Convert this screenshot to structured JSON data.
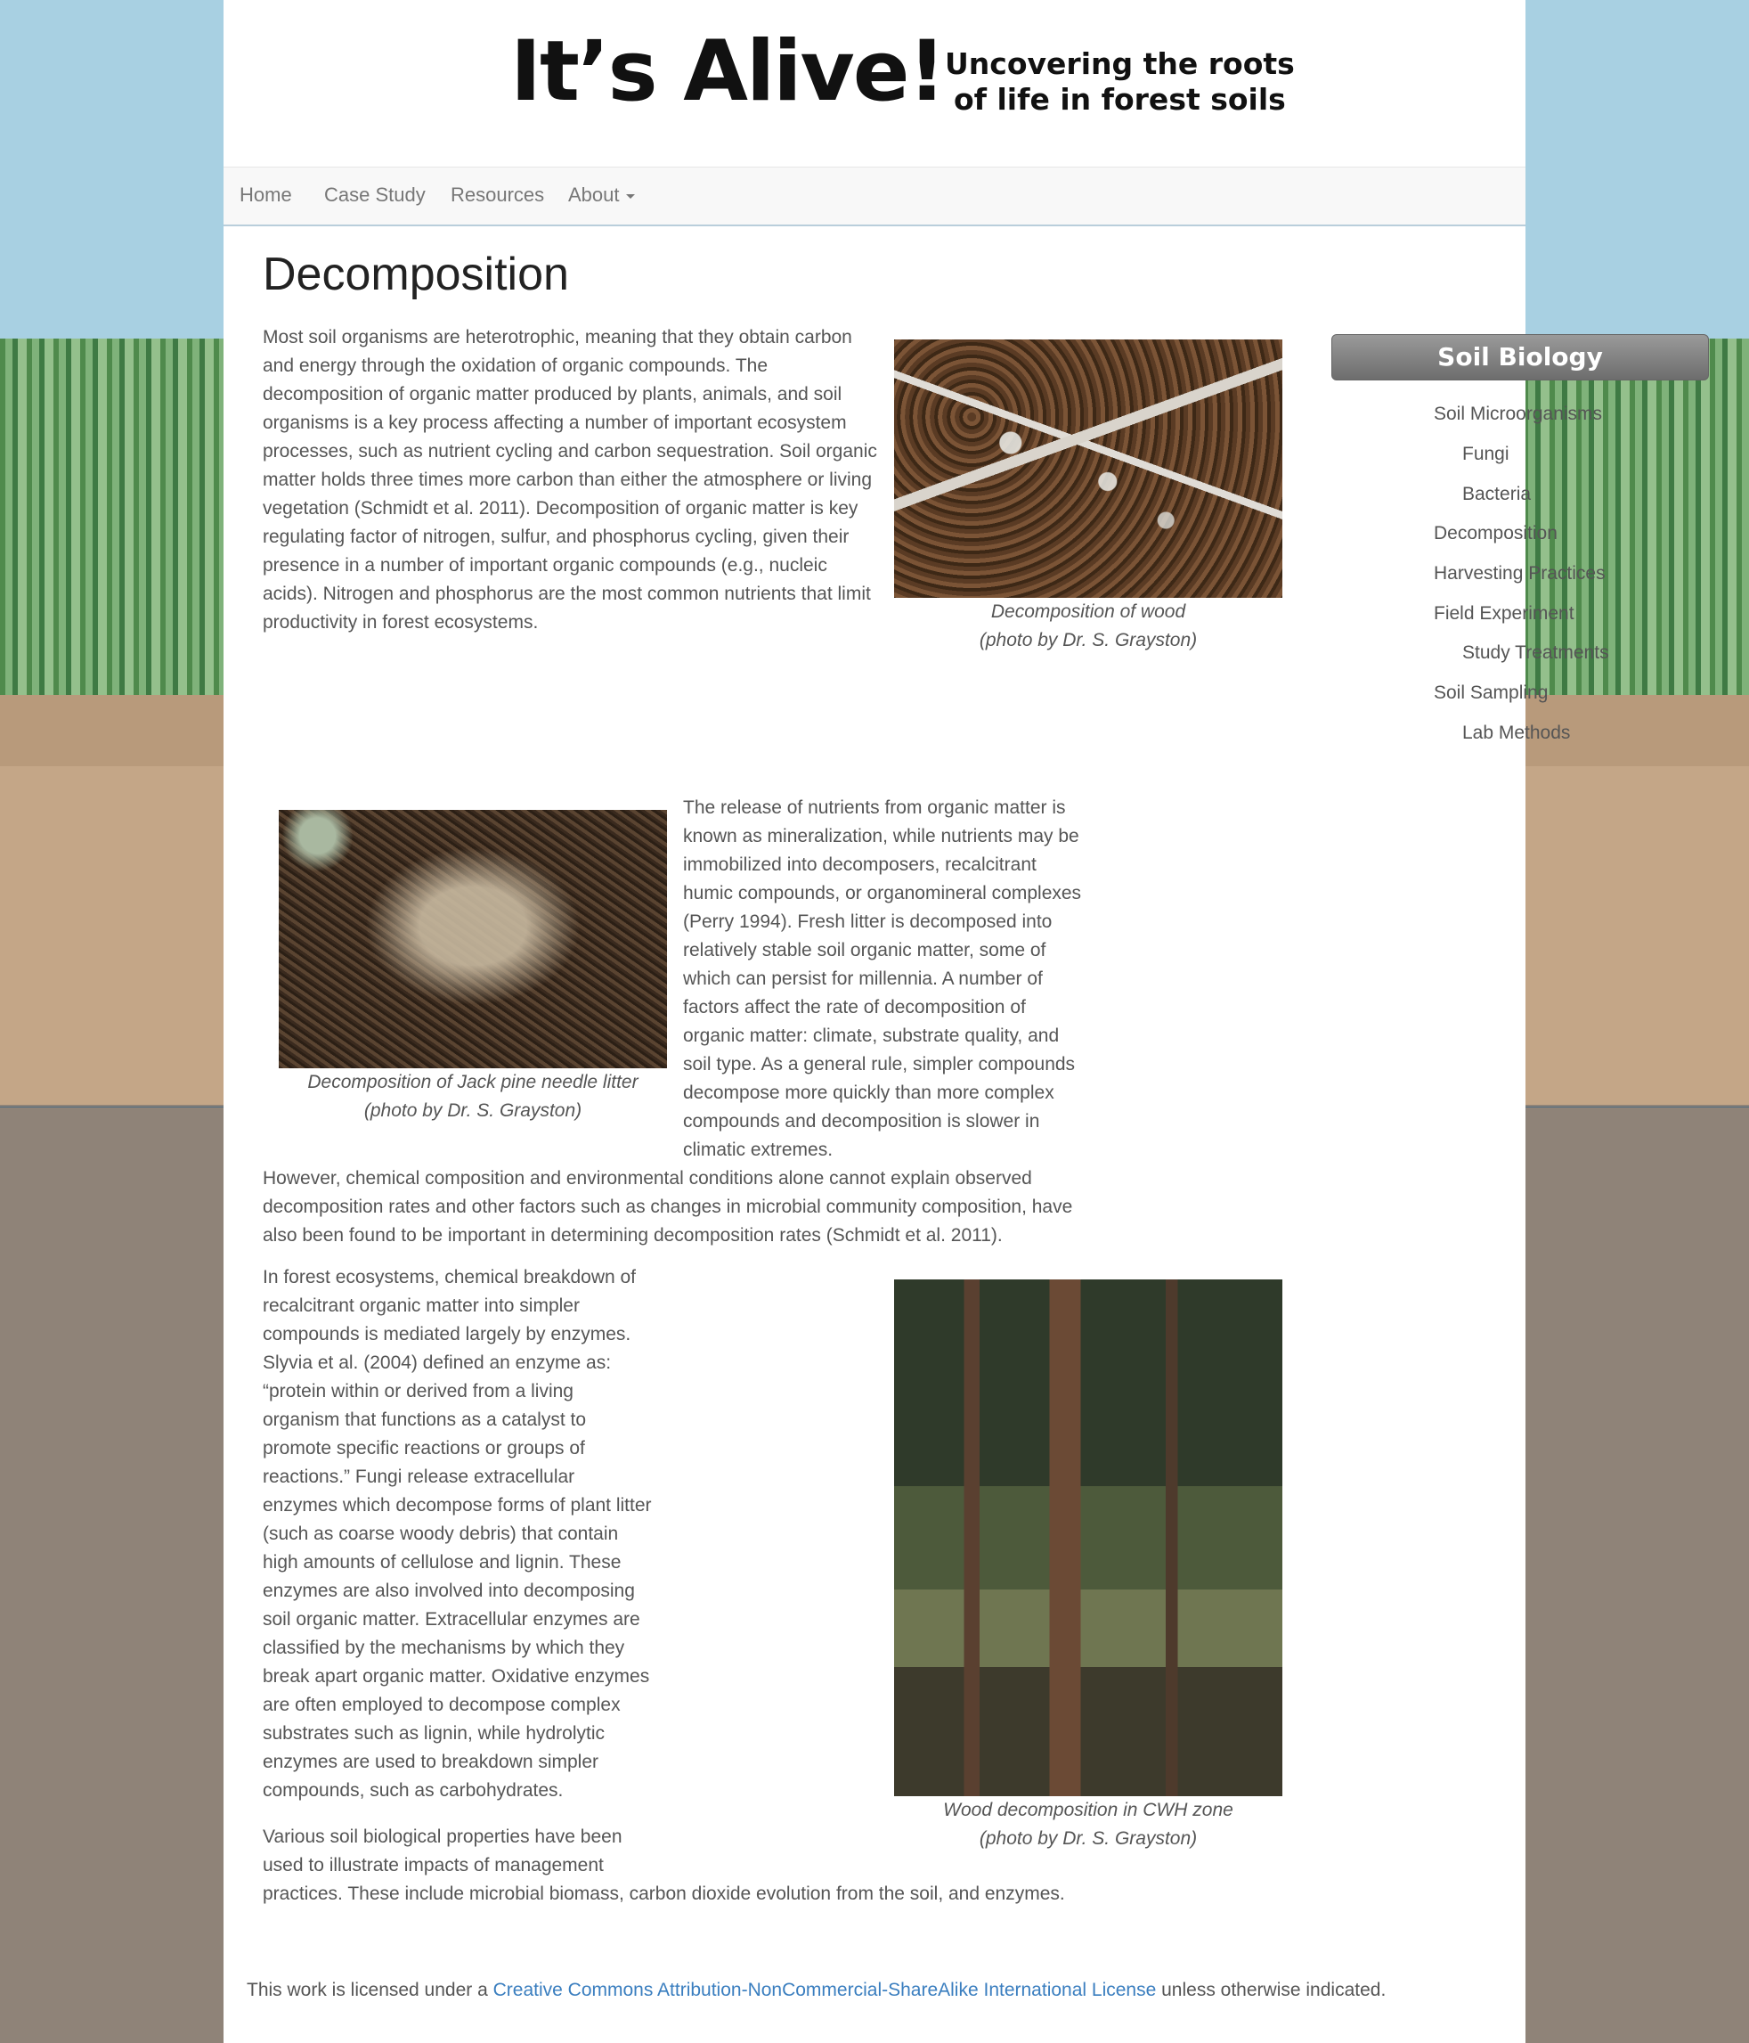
{
  "banner": {
    "logo_title": "It’s Alive!",
    "logo_subtitle_line1": "Uncovering the roots",
    "logo_subtitle_line2": "of life in forest soils"
  },
  "nav": {
    "items": [
      {
        "label": "Home"
      },
      {
        "label": "Case Study"
      },
      {
        "label": "Resources"
      },
      {
        "label": "About"
      }
    ]
  },
  "main": {
    "title": "Decomposition",
    "para1": "Most soil organisms are heterotrophic, meaning that they obtain carbon and energy through the oxidation of organic compounds. The decomposition of organic matter produced by plants, animals, and soil organisms is a key process affecting a number of important ecosystem processes, such as nutrient cycling and carbon sequestration. Soil organic matter holds three times more carbon than either the atmosphere or living vegetation (Schmidt et al. 2011). Decomposition of organic matter is key regulating factor of nitrogen, sulfur, and phosphorus cycling, given their presence in a number of important organic compounds (e.g., nucleic acids). Nitrogen and phosphorus are the most common nutrients that limit productivity in forest ecosystems.",
    "figure1": {
      "caption_line1": "Decomposition of wood",
      "caption_line2": "(photo by Dr. S. Grayston)"
    },
    "para2": "The release of nutrients from organic matter is known as mineralization, while nutrients may be immobilized into decomposers, recalcitrant humic compounds, or organomineral complexes (Perry 1994). Fresh litter is decomposed into relatively stable soil organic matter, some of which can persist for millennia.  A number of factors affect the rate of decomposition of organic matter: climate, substrate quality, and soil type. As a general rule, simpler compounds decompose more quickly than more complex compounds and decomposition is slower in climatic extremes.",
    "para2_cont": "However, chemical composition and environmental conditions alone cannot explain observed decomposition rates and other factors such as changes in microbial community composition, have also been found to be important in determining decomposition rates (Schmidt et al. 2011).",
    "figure2": {
      "caption_line1": "Decomposition of Jack pine needle litter",
      "caption_line2": "(photo by Dr. S. Grayston)"
    },
    "para3": "In forest ecosystems, chemical breakdown of recalcitrant organic matter into simpler compounds is mediated largely by enzymes. Slyvia et al. (2004) defined an enzyme as: “protein within or derived from a living organism that functions as a catalyst to promote specific reactions or groups of reactions.” Fungi release extracellular enzymes which decompose forms of plant litter (such as coarse woody debris) that contain high amounts of cellulose and lignin. These enzymes are also involved into decomposing soil organic matter.  Extracellular enzymes are classified by the mechanisms by which they break apart organic matter. Oxidative enzymes are often employed to decompose complex substrates such as lignin, while hydrolytic enzymes are used to breakdown simpler compounds, such as carbohydrates.",
    "figure3": {
      "caption_line1": "Wood decomposition in CWH zone",
      "caption_line2": "(photo by Dr. S. Grayston)"
    },
    "para4_line1": "Various soil biological properties have been",
    "para4_line2": "used to illustrate impacts of management",
    "para4_line3": "practices. These include microbial biomass, carbon dioxide evolution from the soil, and enzymes."
  },
  "sidebar": {
    "heading": "Soil Biology",
    "items": [
      {
        "label": "Soil Microorganisms"
      },
      {
        "label": "Fungi"
      },
      {
        "label": "Bacteria"
      },
      {
        "label": "Decomposition"
      },
      {
        "label": "Harvesting Practices"
      },
      {
        "label": "Field Experiment"
      },
      {
        "label": "Study Treatments"
      },
      {
        "label": "Soil Sampling"
      },
      {
        "label": "Lab Methods"
      }
    ]
  },
  "footer": {
    "prefix": "This work is licensed under a ",
    "link": "Creative Commons Attribution-NonCommercial-ShareAlike International License",
    "suffix": " unless otherwise indicated."
  },
  "colors": {
    "link": "#3a7ebf",
    "body_text": "#555555",
    "sky": "#a8d0e2"
  }
}
